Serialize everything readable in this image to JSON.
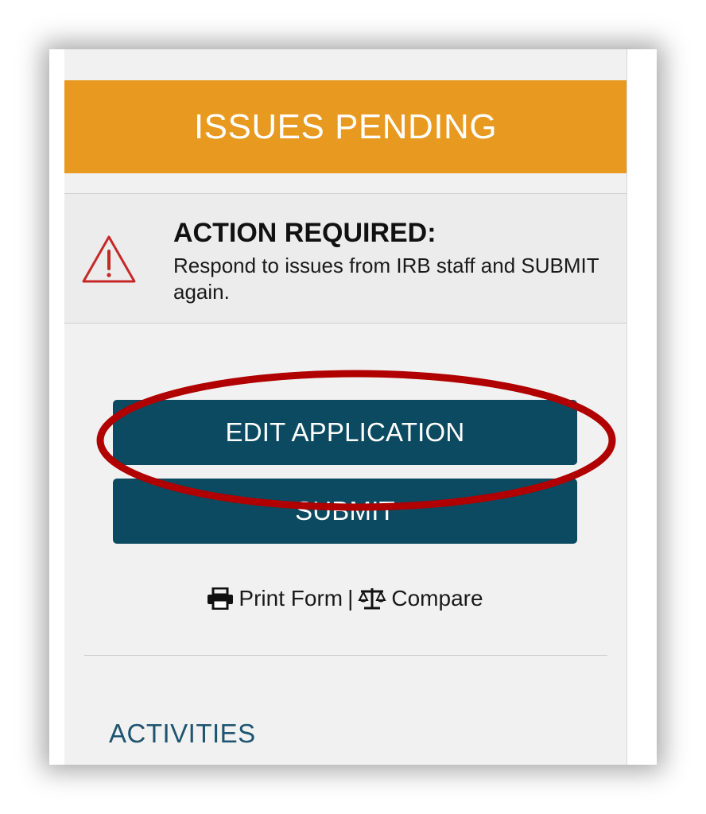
{
  "status_banner": {
    "text": "ISSUES PENDING",
    "color": "#e8991f"
  },
  "action": {
    "title": "ACTION REQUIRED:",
    "description": "Respond to issues from IRB staff and SUBMIT again.",
    "icon": "warning-triangle-icon",
    "icon_color": "#c62828"
  },
  "buttons": {
    "edit_label": "EDIT APPLICATION",
    "submit_label": "SUBMIT",
    "color": "#0b4a60"
  },
  "links": {
    "print_label": "Print Form",
    "separator": "|",
    "compare_label": "Compare",
    "print_icon": "printer-icon",
    "compare_icon": "balance-scale-icon"
  },
  "sections": {
    "activities_label": "ACTIVITIES"
  },
  "annotation": {
    "type": "highlight-ellipse",
    "color": "#b00000"
  }
}
